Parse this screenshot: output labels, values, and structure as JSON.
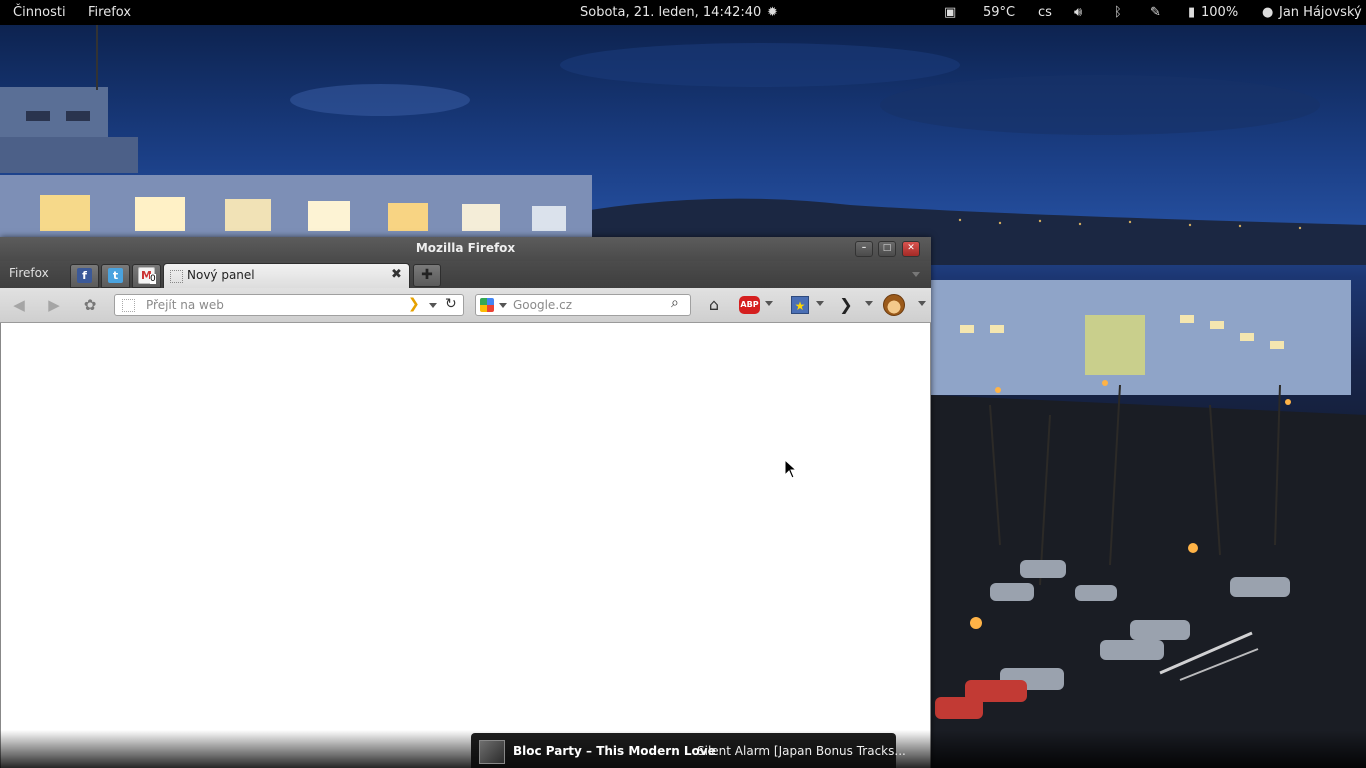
{
  "topbar": {
    "activities": "Činnosti",
    "app_menu": "Firefox",
    "clock": "Sobota, 21. leden, 14:42:40",
    "temperature": "59°C",
    "keyboard_layout": "cs",
    "battery": "100%",
    "user": "Jan Hájovský"
  },
  "window": {
    "title": "Mozilla Firefox",
    "menu_button": "Firefox",
    "active_tab_label": "Nový panel",
    "url_placeholder": "Přejít na web",
    "search_placeholder": "Google.cz",
    "abp_label": "ABP",
    "gmail_count": "0"
  },
  "notification": {
    "title": "Bloc Party – This Modern Love",
    "album": "Silent Alarm [Japan Bonus Tracks..."
  }
}
